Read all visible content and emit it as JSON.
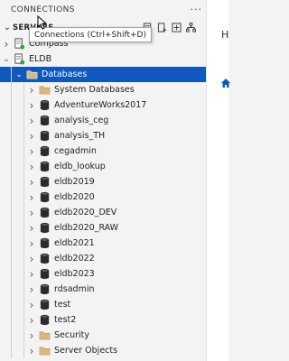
{
  "panel": {
    "title": "CONNECTIONS",
    "more_label": "···"
  },
  "section": {
    "title": "SERVERS"
  },
  "tooltip": {
    "text": "Connections (Ctrl+Shift+D)"
  },
  "right_panel": {
    "tab_label": "H"
  },
  "tree": [
    {
      "label": "Compass",
      "icon": "server-icon",
      "status": "green",
      "expanded": false
    },
    {
      "label": "ELDB",
      "icon": "server-icon",
      "status": "green",
      "expanded": true
    },
    {
      "label": "Databases",
      "icon": "folder-icon",
      "expanded": true,
      "selected": true
    },
    {
      "label": "System Databases",
      "icon": "folder-icon"
    },
    {
      "label": "AdventureWorks2017",
      "icon": "database-icon"
    },
    {
      "label": "analysis_ceg",
      "icon": "database-icon"
    },
    {
      "label": "analysis_TH",
      "icon": "database-icon"
    },
    {
      "label": "cegadmin",
      "icon": "database-icon"
    },
    {
      "label": "eldb_lookup",
      "icon": "database-icon"
    },
    {
      "label": "eldb2019",
      "icon": "database-icon"
    },
    {
      "label": "eldb2020",
      "icon": "database-icon"
    },
    {
      "label": "eldb2020_DEV",
      "icon": "database-icon"
    },
    {
      "label": "eldb2020_RAW",
      "icon": "database-icon"
    },
    {
      "label": "eldb2021",
      "icon": "database-icon"
    },
    {
      "label": "eldb2022",
      "icon": "database-icon"
    },
    {
      "label": "eldb2023",
      "icon": "database-icon"
    },
    {
      "label": "rdsadmin",
      "icon": "database-icon"
    },
    {
      "label": "test",
      "icon": "database-icon"
    },
    {
      "label": "test2",
      "icon": "database-icon"
    },
    {
      "label": "Security",
      "icon": "folder-icon"
    },
    {
      "label": "Server Objects",
      "icon": "folder-icon"
    }
  ],
  "colors": {
    "selection": "#0f58c0",
    "folder": "#dcb67a",
    "database": "#2b2b2b",
    "status_green": "#2ea043",
    "accent": "#0f58c0"
  }
}
